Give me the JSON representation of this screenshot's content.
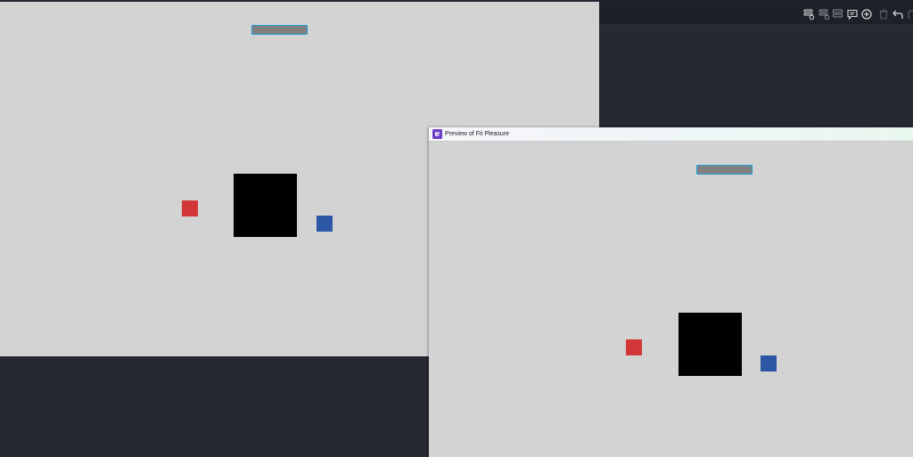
{
  "editor": {
    "toolbar_icons": [
      {
        "name": "layers-settings-icon"
      },
      {
        "name": "layers-timer-icon"
      },
      {
        "name": "rename-icon"
      },
      {
        "name": "comment-icon"
      },
      {
        "name": "add-circle-icon"
      },
      {
        "name": "delete-icon"
      },
      {
        "name": "undo-icon"
      },
      {
        "name": "redo-icon"
      }
    ],
    "scene": {
      "background": "#d3d3d3",
      "objects": [
        {
          "name": "platform",
          "color": "#808080",
          "outline": "#1aa3d8"
        },
        {
          "name": "player-square",
          "color": "#000000"
        },
        {
          "name": "red-square",
          "color": "#d23737"
        },
        {
          "name": "blue-square",
          "color": "#2b57a4"
        }
      ]
    }
  },
  "preview": {
    "title": "Preview of Fit Pleasure",
    "app_icon": "game-engine-icon"
  },
  "colors": {
    "editor_background": "#262932",
    "toolbar_background": "#1e2027",
    "icon_color": "#d9dbe0",
    "icon_disabled": "#5d616b"
  }
}
